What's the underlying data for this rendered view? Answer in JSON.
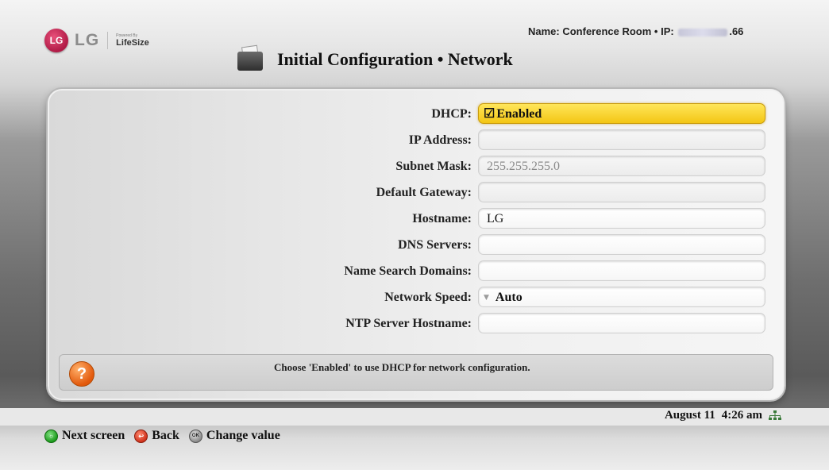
{
  "header": {
    "brand_logo_letters": "LG",
    "brand_text": "LG",
    "powered_by": "Powered By",
    "lifesize": "LifeSize",
    "name_label": "Name: Conference Room • IP:",
    "ip_suffix": ".66",
    "title": "Initial Configuration • Network"
  },
  "form": {
    "dhcp_label": "DHCP:",
    "dhcp_value": "Enabled",
    "ip_label": "IP Address:",
    "ip_value": "",
    "subnet_label": "Subnet Mask:",
    "subnet_value": "255.255.255.0",
    "gateway_label": "Default Gateway:",
    "gateway_value": "",
    "hostname_label": "Hostname:",
    "hostname_value": "LG",
    "dns_label": "DNS Servers:",
    "dns_value": "",
    "search_label": "Name Search Domains:",
    "search_value": "",
    "speed_label": "Network Speed:",
    "speed_value": "Auto",
    "ntp_label": "NTP Server Hostname:",
    "ntp_value": ""
  },
  "help": {
    "text": "Choose 'Enabled' to use DHCP for network configuration."
  },
  "status": {
    "date": "August 11",
    "time": "4:26 am"
  },
  "footer": {
    "next": "Next screen",
    "back": "Back",
    "change": "Change value",
    "ok_badge": "OK"
  },
  "colors": {
    "selected_field": "#f3c614",
    "help_icon": "#e2590c",
    "next_button": "#1d9b1d",
    "back_button": "#d0321c"
  }
}
